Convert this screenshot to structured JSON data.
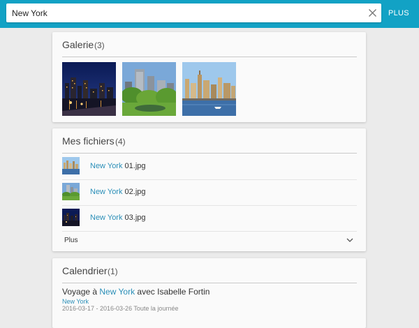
{
  "search": {
    "value": "New York",
    "more_label": "PLUS"
  },
  "gallery": {
    "title": "Galerie",
    "count": "(3)",
    "images": [
      "ny-night-skyline",
      "central-park-skyline",
      "manhattan-skyline-harbor"
    ]
  },
  "files": {
    "title": "Mes fichiers",
    "count": "(4)",
    "items": [
      {
        "highlight": "New York",
        "rest": " 01.jpg",
        "thumb": "manhattan-skyline-harbor"
      },
      {
        "highlight": "New York",
        "rest": " 02.jpg",
        "thumb": "central-park-skyline"
      },
      {
        "highlight": "New York",
        "rest": " 03.jpg",
        "thumb": "ny-night-skyline"
      }
    ],
    "more_label": "Plus"
  },
  "calendar": {
    "title": "Calendrier",
    "count": "(1)",
    "event": {
      "prefix": "Voyage à ",
      "highlight": "New York",
      "suffix": " avec Isabelle Fortin",
      "location": "New York",
      "dates": "2016-03-17 - 2016-03-26 Toute la journée"
    }
  },
  "colors": {
    "accent": "#12a2c5",
    "link": "#2b8fb8",
    "background": "#ebebeb"
  }
}
